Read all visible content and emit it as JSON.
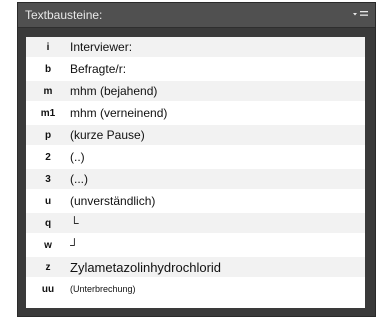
{
  "panel": {
    "title": "Textbausteine:",
    "menu_icon": "panel-menu-icon"
  },
  "rows": [
    {
      "key": "i",
      "text": "Interviewer:"
    },
    {
      "key": "b",
      "text": "Befragte/r:"
    },
    {
      "key": "m",
      "text": "mhm (bejahend)"
    },
    {
      "key": "m1",
      "text": "mhm (verneinend)"
    },
    {
      "key": "p",
      "text": "(kurze Pause)"
    },
    {
      "key": "2",
      "text": "(..)"
    },
    {
      "key": "3",
      "text": "(...)"
    },
    {
      "key": "u",
      "text": "(unverständlich)"
    },
    {
      "key": "q",
      "text": "└"
    },
    {
      "key": "w",
      "text": "┘"
    },
    {
      "key": "z",
      "text": "Zylametazolinhydrochlorid"
    },
    {
      "key": "uu",
      "text": "(Unterbrechung)"
    }
  ]
}
